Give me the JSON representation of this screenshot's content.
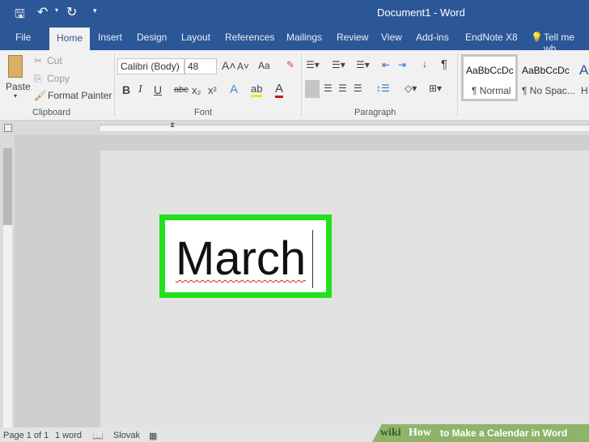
{
  "window": {
    "title": "Document1  -  Word"
  },
  "tabs": [
    "File",
    "Home",
    "Insert",
    "Design",
    "Layout",
    "References",
    "Mailings",
    "Review",
    "View",
    "Add-ins",
    "EndNote X8"
  ],
  "tell_me": "Tell me wh",
  "clipboard": {
    "paste": "Paste",
    "cut": "Cut",
    "copy": "Copy",
    "format_painter": "Format Painter",
    "label": "Clipboard"
  },
  "font": {
    "name": "Calibri (Body)",
    "size": "48",
    "change_case": "Aa",
    "label": "Font",
    "bold": "B",
    "italic": "I",
    "underline": "U",
    "strike": "abc",
    "sub": "x₂",
    "sup": "x²"
  },
  "paragraph": {
    "label": "Paragraph",
    "pilcrow": "¶"
  },
  "styles": [
    {
      "preview": "AaBbCcDc",
      "name": "¶ Normal"
    },
    {
      "preview": "AaBbCcDc",
      "name": "¶ No Spac..."
    },
    {
      "preview": "A",
      "name": "H"
    }
  ],
  "document": {
    "text": "March"
  },
  "status": {
    "page": "Page 1 of 1",
    "words": "1 word",
    "language": "Slovak"
  },
  "watermark": {
    "wiki": "wiki",
    "how": "How",
    "title": "to Make a Calendar in Word"
  },
  "colors": {
    "accent": "#2b5797",
    "highlight": "#22e01c"
  }
}
